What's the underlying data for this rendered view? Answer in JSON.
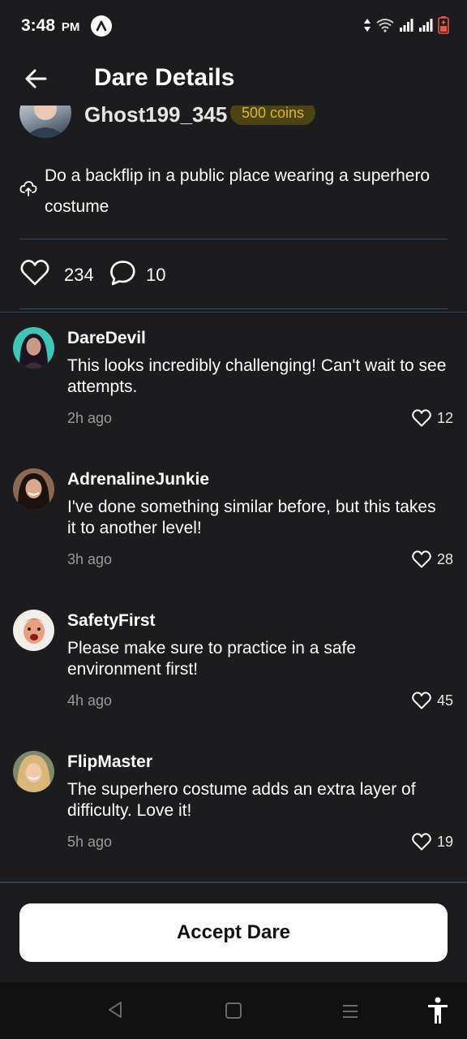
{
  "status_bar": {
    "time": "3:48",
    "ampm": "PM",
    "app_icon": "a-letter-icon",
    "right_icons": [
      "data-arrows-icon",
      "wifi-icon",
      "signal-icon",
      "signal-icon",
      "battery-icon"
    ]
  },
  "header": {
    "back_icon": "arrow-left-icon",
    "title": "Dare Details"
  },
  "dare": {
    "creator": "Ghost199_345",
    "coins": "500 coins",
    "category_icon": "cloud-upload-icon",
    "text": "Do a backflip in a public place wearing a superhero costume",
    "likes": "234",
    "comments_count": "10"
  },
  "comments": [
    {
      "user": "DareDevil",
      "text": "This looks incredibly challenging! Can't wait to see attempts.",
      "time": "2h ago",
      "likes": "12"
    },
    {
      "user": "AdrenalineJunkie",
      "text": "I've done something similar before, but this takes it to another level!",
      "time": "3h ago",
      "likes": "28"
    },
    {
      "user": "SafetyFirst",
      "text": "Please make sure to practice in a safe environment first!",
      "time": "4h ago",
      "likes": "45"
    },
    {
      "user": "FlipMaster",
      "text": "The superhero costume adds an extra layer of difficulty. Love it!",
      "time": "5h ago",
      "likes": "19"
    }
  ],
  "actions": {
    "accept_label": "Accept Dare"
  },
  "nav_bar": {
    "icons": [
      "back-triangle-icon",
      "home-square-icon",
      "menu-lines-icon",
      "accessibility-icon"
    ]
  },
  "colors": {
    "background": "#1c1c1e",
    "divider": "#3a4756",
    "coin_badge_bg": "#4a4413",
    "coin_badge_text": "#d9b825",
    "muted_text": "#9a9a9a",
    "button_bg": "#ffffff"
  }
}
